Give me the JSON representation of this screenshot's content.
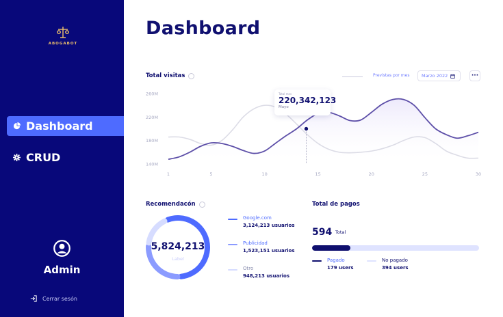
{
  "sidebar": {
    "brand": "ABOGABOT",
    "items": [
      {
        "label": "Dashboard",
        "icon": "pie-chart-icon"
      },
      {
        "label": "CRUD",
        "icon": "gear-icon"
      }
    ],
    "user": "Admin",
    "logout": "Cerrar sesón"
  },
  "header": {
    "title": "Dashboard"
  },
  "visits": {
    "title": "Total visitas",
    "legend": "Previstas por mes",
    "month": "Marzo 2022",
    "more": "···",
    "tooltip": {
      "small": "Total mes",
      "value": "220,342,123",
      "month": "Mayo"
    }
  },
  "chart_data": {
    "type": "line",
    "x": [
      1,
      2,
      3,
      4,
      5,
      6,
      7,
      8,
      9,
      10,
      11,
      12,
      13,
      14,
      15,
      16,
      17,
      18,
      19,
      20,
      21,
      22,
      23,
      24,
      25,
      26,
      27,
      28,
      29,
      30
    ],
    "xticks": [
      "1",
      "5",
      "10",
      "15",
      "20",
      "25",
      "30"
    ],
    "yticks": [
      "260M",
      "220M",
      "180M",
      "140M"
    ],
    "ylim": [
      140,
      260
    ],
    "series": [
      {
        "color": "#5d4fa8",
        "values": [
          148,
          152,
          160,
          170,
          176,
          175,
          170,
          163,
          158,
          162,
          175,
          188,
          200,
          215,
          226,
          228,
          222,
          214,
          215,
          228,
          242,
          250,
          250,
          240,
          219,
          200,
          190,
          184,
          188,
          194
        ]
      },
      {
        "color": "#dcdce6",
        "values": [
          186,
          186,
          182,
          175,
          172,
          180,
          198,
          220,
          234,
          240,
          237,
          225,
          208,
          190,
          175,
          165,
          160,
          159,
          160,
          162,
          166,
          172,
          180,
          186,
          185,
          175,
          162,
          155,
          150,
          150
        ]
      }
    ],
    "highlight": {
      "x": 13.9,
      "y": 200
    }
  },
  "recommendation": {
    "title": "Recomendacón",
    "total": "5,824,213",
    "label": "Label",
    "items": [
      {
        "name": "Google.com",
        "count": "3,124,213 usuarios",
        "color": "#4e6bff",
        "share": 0.536
      },
      {
        "name": "Publicidad",
        "count": "1,523,151 usuarios",
        "color": "#8b9bff",
        "share": 0.262
      },
      {
        "name": "Otro",
        "count": "948,213 usuarios",
        "color": "#d6dcff",
        "share": 0.163
      }
    ]
  },
  "payments": {
    "title": "Total de pagos",
    "total": "594",
    "total_label": "Total",
    "paid_fraction": 0.23,
    "items": [
      {
        "name": "Pagado",
        "count": "179 users",
        "color": "#0f0f6e"
      },
      {
        "name": "No pagado",
        "count": "394 users",
        "color": "#dfe3ff"
      }
    ]
  }
}
